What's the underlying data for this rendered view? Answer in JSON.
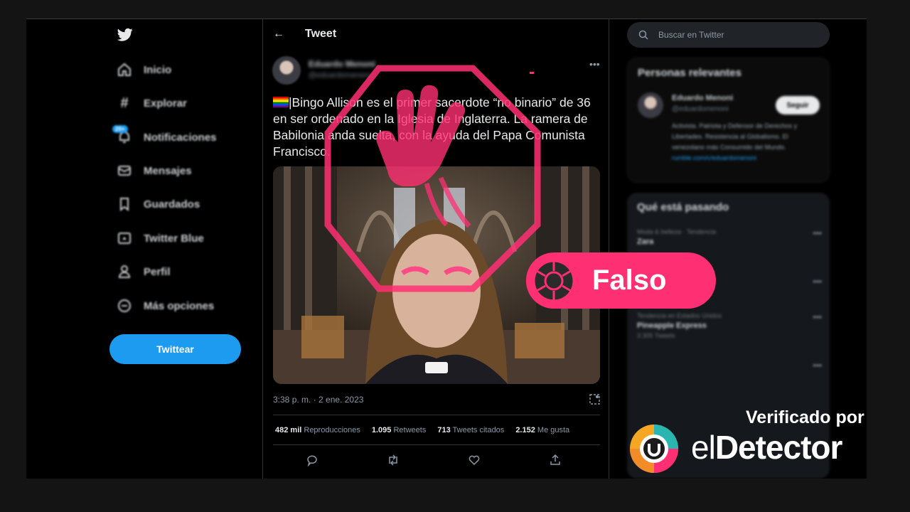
{
  "nav": {
    "items": [
      {
        "label": "Inicio",
        "icon": "home-icon"
      },
      {
        "label": "Explorar",
        "icon": "hashtag-icon"
      },
      {
        "label": "Notificaciones",
        "icon": "bell-icon",
        "badge": "20+"
      },
      {
        "label": "Mensajes",
        "icon": "envelope-icon"
      },
      {
        "label": "Guardados",
        "icon": "bookmark-icon"
      },
      {
        "label": "Twitter Blue",
        "icon": "twitter-blue-icon"
      },
      {
        "label": "Perfil",
        "icon": "person-icon"
      },
      {
        "label": "Más opciones",
        "icon": "more-circle-icon"
      }
    ],
    "tweet_button": "Twittear"
  },
  "header": {
    "back": "←",
    "title": "Tweet"
  },
  "tweet": {
    "author_name": "Eduardo Menoni",
    "author_handle": "@eduardomenoni",
    "text": "|Bingo Allison es el primer sacerdote “no binario” de 36 en ser ordenado en la Iglesia de Inglaterra. La ramera de Babilonia anda suelta, con la ayuda del Papa Comunista Francisco.",
    "timestamp": "3:38 p. m. · 2 ene. 2023",
    "stats": [
      {
        "value": "482 mil",
        "label": "Reproducciones"
      },
      {
        "value": "1.095",
        "label": "Retweets"
      },
      {
        "value": "713",
        "label": "Tweets citados"
      },
      {
        "value": "2.152",
        "label": "Me gusta"
      }
    ]
  },
  "search": {
    "placeholder": "Buscar en Twitter"
  },
  "relevant": {
    "title": "Personas relevantes",
    "name": "Eduardo Menoni",
    "handle": "@eduardomenoni",
    "follow": "Seguir",
    "bio": "Activista. Patriota y Defensor de Derechos y Libertades. Resistencia al Globalismo. El venezolano más Consumido del Mundo.",
    "link": "rumble.com/c/eduardomenoni"
  },
  "trends": {
    "title": "Qué está pasando",
    "items": [
      {
        "category": "Moda & belleza · Tendencia",
        "name": "Zara",
        "count": ""
      },
      {
        "category": "Tendencia",
        "name": "",
        "count": ""
      },
      {
        "category": "Tendencia en Estados Unidos",
        "name": "Pineapple Express",
        "count": "3.305 Tweets"
      },
      {
        "category": "",
        "name": "",
        "count": ""
      }
    ]
  },
  "overlay": {
    "verdict": "Falso",
    "verified_by": "Verificado por",
    "brand_prefix": "el",
    "brand_suffix": "Detector",
    "accent": "#ff2f73"
  }
}
